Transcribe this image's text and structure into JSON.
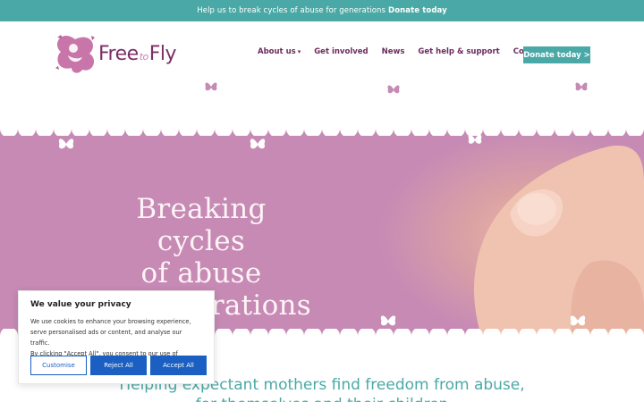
{
  "top_banner": {
    "text": "Help us to break cycles of abuse for generations",
    "link": "Donate today"
  },
  "logo": {
    "free": "Free",
    "to": "to",
    "fly": "Fly"
  },
  "nav": {
    "items": [
      {
        "label": "About us",
        "has_dropdown": true
      },
      {
        "label": "Get involved"
      },
      {
        "label": "News"
      },
      {
        "label": "Get help & support"
      },
      {
        "label": "Contact us"
      }
    ],
    "donate": "Donate today >"
  },
  "hero": {
    "title_line1": "Breaking cycles",
    "title_line2": "of abuse",
    "title_line3": "for generations"
  },
  "mission": {
    "text": "Helping expectant mothers find freedom from abuse, for themselves and their children"
  },
  "cookie": {
    "title": "We value your privacy",
    "body_line1": "We use cookies to enhance your browsing experience,",
    "body_line2": "serve personalised ads or content, and analyse our traffic.",
    "body_line3": "By clicking \"Accept All\", you consent to our use of cookies.",
    "customise": "Customise",
    "reject": "Reject All",
    "accept": "Accept All"
  },
  "colors": {
    "teal": "#4aa9a6",
    "plum": "#6b2c5c",
    "hero_pink": "#c68ab5",
    "cookie_blue": "#1a5fc1"
  }
}
